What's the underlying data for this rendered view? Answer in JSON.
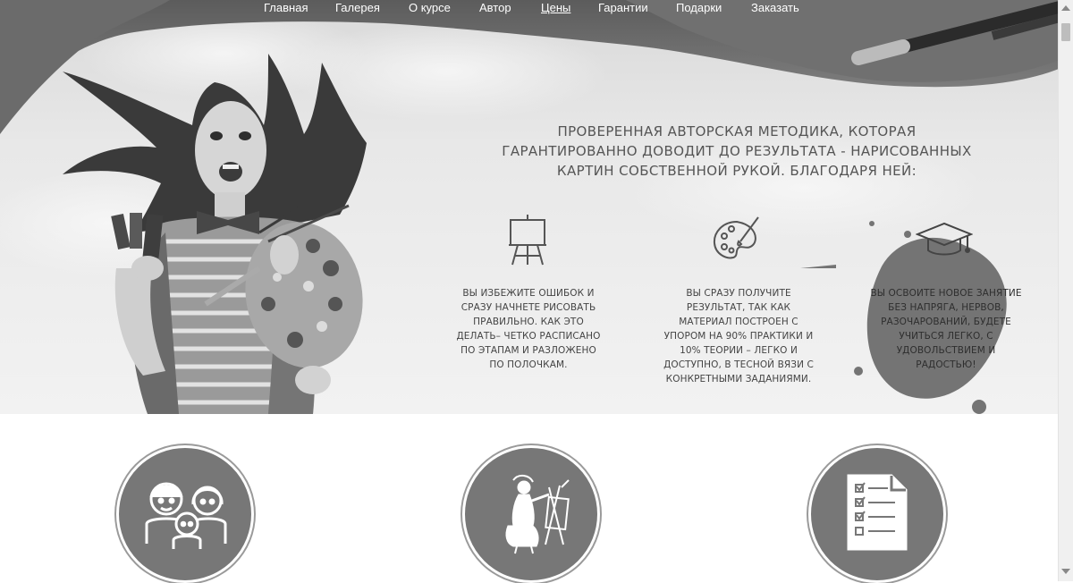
{
  "nav": {
    "items": [
      {
        "label": "Главная"
      },
      {
        "label": "Галерея"
      },
      {
        "label": "О курсе"
      },
      {
        "label": "Автор"
      },
      {
        "label": "Цены",
        "active": true
      },
      {
        "label": "Гарантии"
      },
      {
        "label": "Подарки"
      },
      {
        "label": "Заказать"
      }
    ]
  },
  "hero": {
    "headline": "ПРОВЕРЕННАЯ АВТОРСКАЯ МЕТОДИКА, КОТОРАЯ ГАРАНТИРОВАННО ДОВОДИТ ДО РЕЗУЛЬТАТА - НАРИСОВАННЫХ КАРТИН СОБСТВЕННОЙ РУКОЙ. БЛАГОДАРЯ НЕЙ:",
    "features": [
      {
        "icon": "easel-icon",
        "text": "ВЫ ИЗБЕЖИТЕ ОШИБОК И СРАЗУ НАЧНЕТЕ РИСОВАТЬ ПРАВИЛЬНО. КАК ЭТО ДЕЛАТЬ– ЧЕТКО РАСПИСАНО ПО ЭТАПАМ И РАЗЛОЖЕНО ПО ПОЛОЧКАМ."
      },
      {
        "icon": "palette-icon",
        "text": "ВЫ СРАЗУ ПОЛУЧИТЕ РЕЗУЛЬТАТ, ТАК КАК МАТЕРИАЛ ПОСТРОЕН С УПОРОМ НА 90% ПРАКТИКИ И 10% ТЕОРИИ – ЛЕГКО И ДОСТУПНО, В ТЕСНОЙ ВЯЗИ С КОНКРЕТНЫМИ ЗАДАНИЯМИ."
      },
      {
        "icon": "graduation-cap-icon",
        "text": "ВЫ ОСВОИТЕ НОВОЕ ЗАНЯТИЕ БЕЗ НАПРЯГА, НЕРВОВ, РАЗОЧАРОВАНИЙ, БУДЕТЕ УЧИТЬСЯ ЛЕГКО, С УДОВОЛЬСТВИЕМ И РАДОСТЬЮ!"
      }
    ]
  },
  "circles": [
    {
      "icon": "family-icon"
    },
    {
      "icon": "painter-at-easel-icon"
    },
    {
      "icon": "checklist-icon"
    }
  ],
  "colors": {
    "nav_text": "#ffffff",
    "circle_fill": "#777777",
    "text": "#4a4a4a"
  }
}
